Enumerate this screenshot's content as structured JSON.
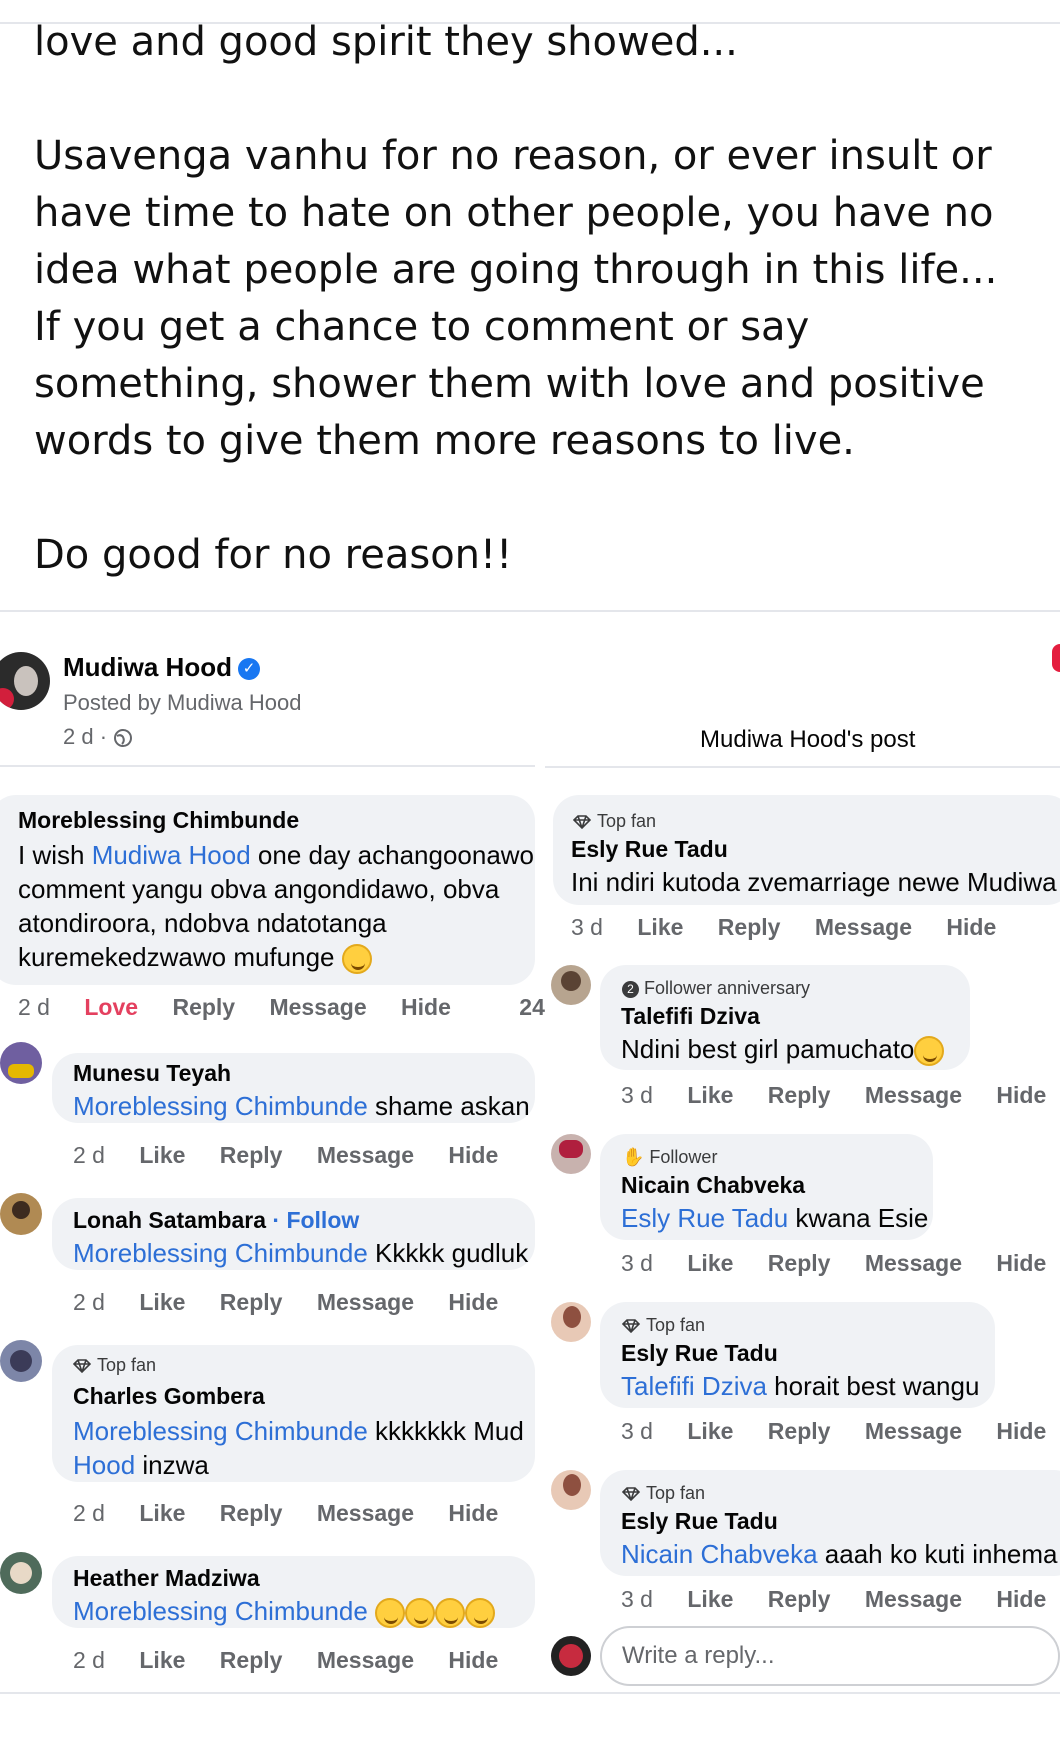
{
  "post": {
    "paragraphs": [
      "love and good spirit they showed...",
      "Usavenga vanhu for no reason, or ever insult or have time to hate on other people, you have no idea what people are going through in this life... If you get a chance to comment or say something, shower them with love and positive words to give them more reasons to live.",
      "Do good for no reason!!"
    ]
  },
  "left": {
    "header": {
      "name": "Mudiwa Hood",
      "posted_by": "Posted by Mudiwa Hood",
      "time": "2 d · "
    },
    "main_comment": {
      "author": "Moreblessing Chimbunde",
      "lines": [
        {
          "pre": "I wish ",
          "link": "Mudiwa Hood",
          "post": " one day achangoonawo"
        },
        {
          "pre": "comment yangu obva angondidawo, obva",
          "link": "",
          "post": ""
        },
        {
          "pre": "atondiroora, ndobva ndatotanga",
          "link": "",
          "post": ""
        },
        {
          "pre": "kuremekedzwawo mufunge ",
          "link": "",
          "post": ""
        }
      ],
      "actions": {
        "time": "2 d",
        "react": "Love",
        "reply": "Reply",
        "message": "Message",
        "hide": "Hide",
        "count": "24"
      }
    },
    "replies": [
      {
        "author": "Munesu Teyah",
        "follow": "",
        "badge": "",
        "link": "Moreblessing Chimbunde",
        "text": " shame askan",
        "time": "2 d"
      },
      {
        "author": "Lonah Satambara",
        "follow": " · Follow",
        "badge": "",
        "link": "Moreblessing Chimbunde",
        "text": " Kkkkk gudluk",
        "time": "2 d"
      },
      {
        "author": "Charles Gombera",
        "follow": "",
        "badge": "Top fan",
        "link": "Moreblessing Chimbunde",
        "text": " kkkkkkk Mud",
        "line2_link": "Hood",
        "line2_text": " inzwa",
        "time": "2 d"
      },
      {
        "author": "Heather Madziwa",
        "follow": "",
        "badge": "",
        "link": "Moreblessing Chimbunde",
        "text": " ",
        "time": "2 d"
      }
    ],
    "reply_actions": {
      "like": "Like",
      "reply": "Reply",
      "message": "Message",
      "hide": "Hide"
    }
  },
  "right": {
    "title": "Mudiwa Hood's post",
    "main_comment": {
      "badge": "Top fan",
      "author": "Esly Rue Tadu",
      "text": "Ini ndiri kutoda zvemarriage newe Mudiwa",
      "time": "3 d"
    },
    "replies": [
      {
        "badge": "Follower anniversary",
        "author": "Talefifi Dziva",
        "link": "",
        "text": "Ndini best girl pamuchato",
        "time": "3 d"
      },
      {
        "badge": "Follower",
        "author": "Nicain Chabveka",
        "link": "Esly Rue Tadu",
        "text": " kwana Esie",
        "time": "3 d"
      },
      {
        "badge": "Top fan",
        "author": "Esly Rue Tadu",
        "link": "Talefifi Dziva",
        "text": " horait best wangu",
        "time": "3 d"
      },
      {
        "badge": "Top fan",
        "author": "Esly Rue Tadu",
        "link": "Nicain Chabveka",
        "text": " aaah ko kuti inhema h",
        "time": "3 d"
      }
    ],
    "actions": {
      "like": "Like",
      "reply": "Reply",
      "message": "Message",
      "hide": "Hide"
    },
    "reply_placeholder": "Write a reply..."
  },
  "colors": {
    "link": "#2d6fd6",
    "love": "#e4405f",
    "bubble": "#f0f2f5",
    "meta": "#65676b",
    "verified": "#1877f2"
  },
  "icons": {
    "verified": "verified-badge-icon",
    "globe": "globe-icon",
    "top_fan": "diamond-icon",
    "follower": "hand-wave-icon",
    "anniversary": "number-badge-icon"
  }
}
